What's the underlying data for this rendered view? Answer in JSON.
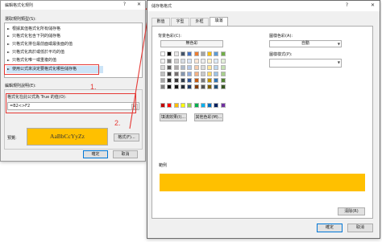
{
  "rule_dialog": {
    "title": "編輯格式化規則",
    "select_type_label": "選取規則類型(S):",
    "rule_types": [
      "根據其值格式化所有儲存格",
      "只格式化包含下列的儲存格",
      "只格式化排在最前面或最後面的值",
      "只格式化高於或低於平均的值",
      "只格式化唯一或重複的值",
      "使用公式來決定要格式化哪些儲存格"
    ],
    "edit_desc_label": "編輯規則說明(E):",
    "formula_label": "格式化在此公式為 True 的值(O):",
    "formula_value": "=B2<>F2",
    "preview_label": "預覽:",
    "preview_text": "AaBbCcYyZz",
    "preview_color": "#ffc000",
    "format_button": "格式(F)...",
    "ok_button": "確定",
    "cancel_button": "取消"
  },
  "annotations": {
    "step1": "1.",
    "step2": "2.",
    "accent": "#e53935"
  },
  "format_dialog": {
    "title": "儲存格格式",
    "tabs": [
      "數值",
      "字型",
      "外框",
      "填滿"
    ],
    "active_tab": "填滿",
    "bg_color_label": "背景色彩(C):",
    "no_color_button": "無色彩",
    "pattern_color_label": "圖樣色彩(A):",
    "pattern_color_value": "自動",
    "pattern_style_label": "圖樣樣式(P):",
    "fill_effects_button": "填滿效果(I)...",
    "more_colors_button": "其他色彩(M)...",
    "sample_label": "範例",
    "sample_color": "#ffc000",
    "clear_button": "清除(R)",
    "ok_button": "確定",
    "cancel_button": "取消",
    "theme_colors": [
      [
        "#ffffff",
        "#000000",
        "#e7e6e6",
        "#44546a",
        "#4472c4",
        "#ed7d31",
        "#a5a5a5",
        "#ffc000",
        "#5b9bd5",
        "#70ad47"
      ],
      [
        "#f2f2f2",
        "#7f7f7f",
        "#d0cece",
        "#d6dce4",
        "#d9e2f3",
        "#fbe5d5",
        "#ededed",
        "#fff2cc",
        "#deebf6",
        "#e2efd9"
      ],
      [
        "#d8d8d8",
        "#595959",
        "#aeaaaa",
        "#adb9ca",
        "#b4c6e7",
        "#f7cbac",
        "#dbdbdb",
        "#fee599",
        "#bdd7ee",
        "#c5e0b3"
      ],
      [
        "#bfbfbf",
        "#3f3f3f",
        "#757070",
        "#8496b0",
        "#8eaadb",
        "#f4b183",
        "#c9c9c9",
        "#ffd965",
        "#9cc3e5",
        "#a8d08d"
      ],
      [
        "#a5a5a5",
        "#262626",
        "#3a3838",
        "#323f4f",
        "#2f5496",
        "#c55a11",
        "#7b7b7b",
        "#bf9000",
        "#2e75b5",
        "#538135"
      ],
      [
        "#7f7f7f",
        "#0c0c0c",
        "#171616",
        "#222a35",
        "#1f3864",
        "#833c0b",
        "#525252",
        "#7f6000",
        "#1e4e79",
        "#375623"
      ]
    ],
    "standard_colors": [
      "#c00000",
      "#ff0000",
      "#ffc000",
      "#ffff00",
      "#92d050",
      "#00b050",
      "#00b0f0",
      "#0070c0",
      "#002060",
      "#7030a0"
    ]
  }
}
